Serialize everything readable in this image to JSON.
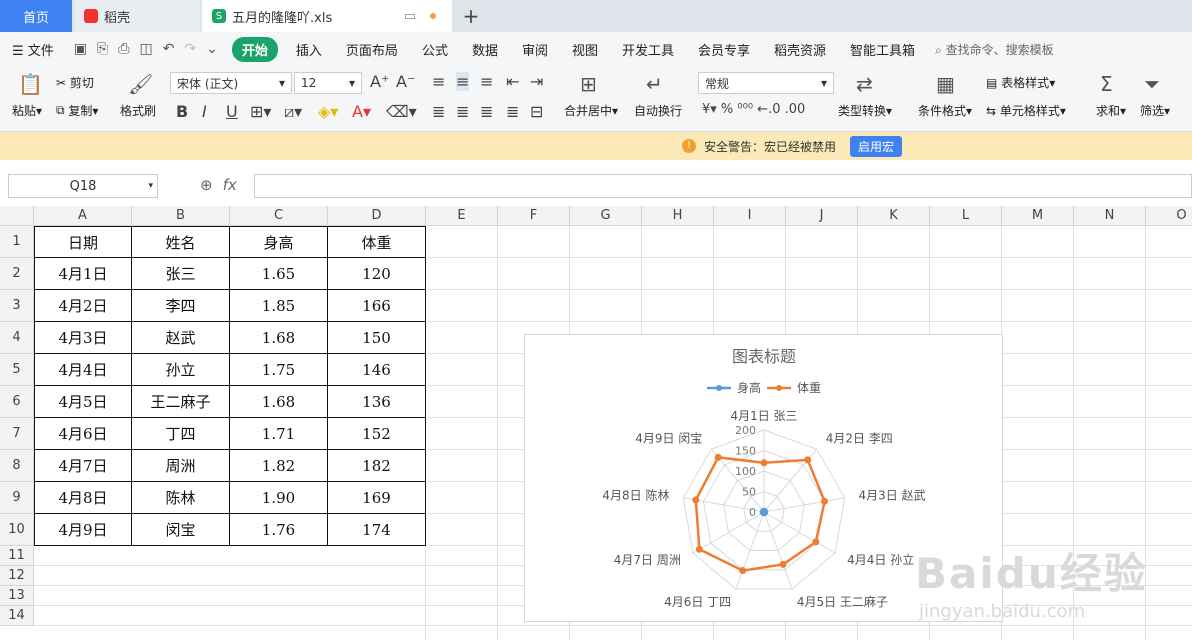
{
  "tabs": {
    "home": "首页",
    "daoke": "稻壳",
    "file": "五月的隆隆吖.xls"
  },
  "menu": {
    "file": "文件",
    "items": [
      "开始",
      "插入",
      "页面布局",
      "公式",
      "数据",
      "审阅",
      "视图",
      "开发工具",
      "会员专享",
      "稻壳资源",
      "智能工具箱"
    ],
    "search": "查找命令、搜索模板"
  },
  "ribbon": {
    "paste": "粘贴",
    "cut": "剪切",
    "copy": "复制",
    "format_painter": "格式刷",
    "font": "宋体 (正文)",
    "size": "12",
    "merge": "合并居中",
    "wrap": "自动换行",
    "numfmt": "常规",
    "convert": "类型转换",
    "cond": "条件格式",
    "table_style": "表格样式",
    "cell_style": "单元格样式",
    "sum": "求和",
    "filter": "筛选"
  },
  "warning": {
    "text": "安全警告：宏已经被禁用",
    "button": "启用宏"
  },
  "formula": {
    "namebox": "Q18",
    "fx": "fx"
  },
  "columns": [
    "A",
    "B",
    "C",
    "D",
    "E",
    "F",
    "G",
    "H",
    "I",
    "J",
    "K",
    "L",
    "M",
    "N",
    "O"
  ],
  "rows": [
    "1",
    "2",
    "3",
    "4",
    "5",
    "6",
    "7",
    "8",
    "9",
    "10",
    "11",
    "12",
    "13",
    "14"
  ],
  "table": {
    "headers": [
      "日期",
      "姓名",
      "身高",
      "体重"
    ],
    "rows": [
      [
        "4月1日",
        "张三",
        "1.65",
        "120"
      ],
      [
        "4月2日",
        "李四",
        "1.85",
        "166"
      ],
      [
        "4月3日",
        "赵武",
        "1.68",
        "150"
      ],
      [
        "4月4日",
        "孙立",
        "1.75",
        "146"
      ],
      [
        "4月5日",
        "王二麻子",
        "1.68",
        "136"
      ],
      [
        "4月6日",
        "丁四",
        "1.71",
        "152"
      ],
      [
        "4月7日",
        "周洲",
        "1.82",
        "182"
      ],
      [
        "4月8日",
        "陈林",
        "1.90",
        "169"
      ],
      [
        "4月9日",
        "闵宝",
        "1.76",
        "174"
      ]
    ]
  },
  "chart_data": {
    "type": "radar",
    "title": "图表标题",
    "categories": [
      "4月1日 张三",
      "4月2日 李四",
      "4月3日 赵武",
      "4月4日 孙立",
      "4月5日 王二麻子",
      "4月6日 丁四",
      "4月7日 周洲",
      "4月8日 陈林",
      "4月9日 闵宝"
    ],
    "series": [
      {
        "name": "身高",
        "color": "#5b9bd5",
        "values": [
          1.65,
          1.85,
          1.68,
          1.75,
          1.68,
          1.71,
          1.82,
          1.9,
          1.76
        ]
      },
      {
        "name": "体重",
        "color": "#ed7d31",
        "values": [
          120,
          166,
          150,
          146,
          136,
          152,
          182,
          169,
          174
        ]
      }
    ],
    "axis": {
      "min": 0,
      "max": 200,
      "ticks": [
        0,
        50,
        100,
        150,
        200
      ]
    },
    "legend": "top"
  },
  "watermark": {
    "brand": "Baidu经验",
    "url": "jingyan.baidu.com"
  }
}
